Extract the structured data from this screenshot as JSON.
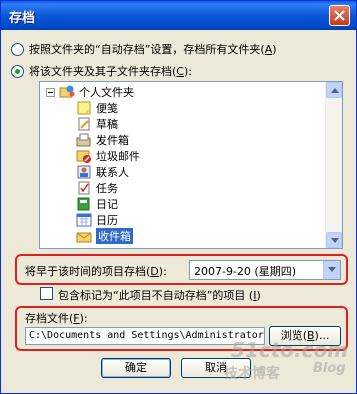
{
  "window": {
    "title": "存档"
  },
  "options": {
    "radio_default": "按照文件夹的“自动存档”设置，存档所有文件夹",
    "radio_default_key": "A",
    "radio_folder": "将该文件夹及其子文件夹存档",
    "radio_folder_key": "C",
    "selected": "radio_folder"
  },
  "tree": {
    "root": "个人文件夹",
    "items": [
      {
        "label": "便笺",
        "icon": "notes-icon"
      },
      {
        "label": "草稿",
        "icon": "drafts-icon"
      },
      {
        "label": "发件箱",
        "icon": "outbox-icon"
      },
      {
        "label": "垃圾邮件",
        "icon": "junk-mail-icon"
      },
      {
        "label": "联系人",
        "icon": "contacts-icon"
      },
      {
        "label": "任务",
        "icon": "tasks-icon"
      },
      {
        "label": "日记",
        "icon": "journal-icon"
      },
      {
        "label": "日历",
        "icon": "calendar-icon"
      },
      {
        "label": "收件箱",
        "icon": "inbox-icon",
        "selected": true
      }
    ]
  },
  "date_filter": {
    "label": "将早于该时间的项目存档",
    "key": "D",
    "value": "2007-9-20 (星期四)"
  },
  "include_checkbox": {
    "label": "包含标记为“此项目不自动存档”的项目",
    "key": "I",
    "checked": false
  },
  "archive_file": {
    "label": "存档文件",
    "key": "F",
    "path": "C:\\Documents and Settings\\Administrator",
    "browse_label": "浏览",
    "browse_key": "B"
  },
  "buttons": {
    "ok": "确定",
    "cancel": "取消"
  },
  "watermark": {
    "site": "51cto.com",
    "blog_cn": "技术博客",
    "blog_en": "Blog"
  },
  "colors": {
    "highlight": "#e0201a",
    "selection": "#316ac5",
    "titlebar": "#0a58d8"
  }
}
